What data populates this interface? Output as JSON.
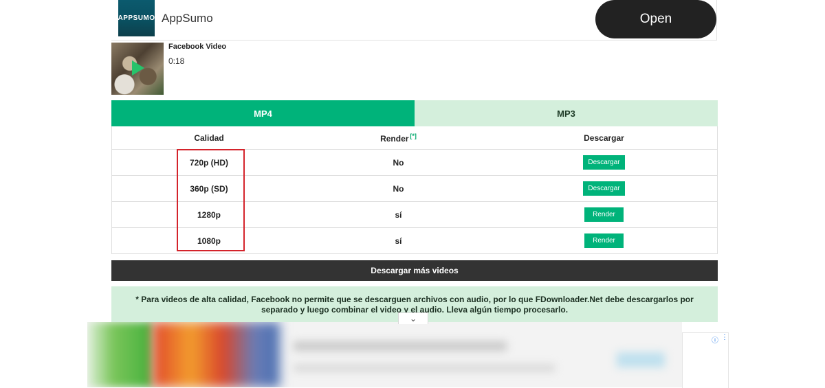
{
  "ad": {
    "logo_text": "APPSUMO",
    "name": "AppSumo",
    "open_label": "Open"
  },
  "video": {
    "title": "Facebook Video",
    "duration": "0:18"
  },
  "tabs": [
    {
      "label": "MP4",
      "active": true
    },
    {
      "label": "MP3",
      "active": false
    }
  ],
  "table": {
    "headers": {
      "quality": "Calidad",
      "render": "Render",
      "render_note": "[*]",
      "download": "Descargar"
    },
    "rows": [
      {
        "quality": "720p (HD)",
        "render": "No",
        "action": "Descargar"
      },
      {
        "quality": "360p (SD)",
        "render": "No",
        "action": "Descargar"
      },
      {
        "quality": "1280p",
        "render": "sí",
        "action": "Render"
      },
      {
        "quality": "1080p",
        "render": "sí",
        "action": "Render"
      }
    ]
  },
  "more_videos_label": "Descargar más videos",
  "note": "* Para videos de alta calidad, Facebook no permite que se descarguen archivos con audio, por lo que FDownloader.Net debe descargarlos por separado y luego combinar el video y el audio. Lleva algún tiempo procesarlo.",
  "colors": {
    "accent": "#00b37a",
    "tab_inactive": "#d4efdc",
    "dark_bar": "#333333",
    "highlight": "#d4232b"
  },
  "icons": {
    "play": "play-icon",
    "chevron": "chevron-down-icon",
    "info": "info-icon",
    "more": "more-vert-icon"
  }
}
